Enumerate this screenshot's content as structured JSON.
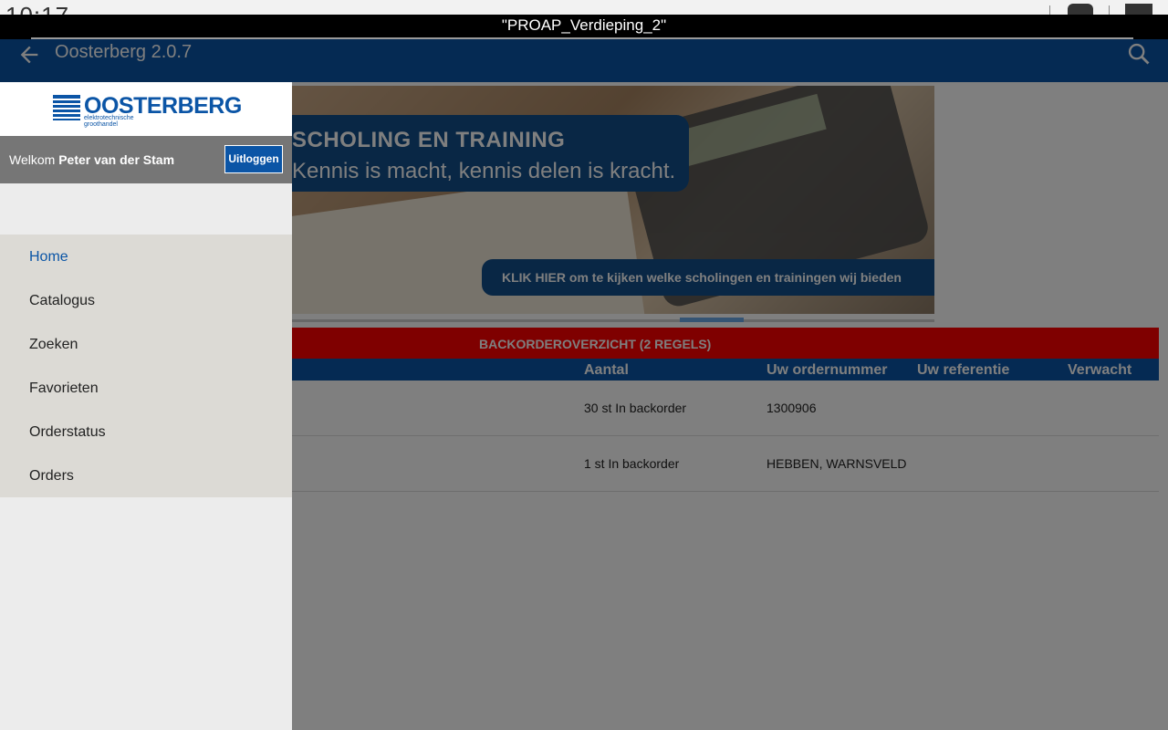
{
  "status_bar": {
    "clock": "10:17"
  },
  "wifi_banner": {
    "text": "\"PROAP_Verdieping_2\""
  },
  "app_bar": {
    "title": "Oosterberg 2.0.7",
    "back_icon": "arrow-left-icon",
    "search_icon": "search-icon"
  },
  "banner": {
    "heading": "SCHOLING EN TRAINING",
    "subheading": "Kennis is macht, kennis delen is kracht.",
    "cta": "KLIK HIER om te kijken welke scholingen en trainingen wij bieden"
  },
  "backorder": {
    "title": "BACKORDEROVERZICHT (2 REGELS)",
    "columns": [
      "Aantal",
      "Uw ordernummer",
      "Uw referentie",
      "Verwacht"
    ],
    "rows": [
      {
        "aantal": "30 st In backorder",
        "ordernummer": "1300906",
        "referentie": "",
        "verwacht": ""
      },
      {
        "aantal": "1 st In backorder",
        "ordernummer": "HEBBEN, WARNSVELD",
        "referentie": "",
        "verwacht": ""
      }
    ]
  },
  "drawer": {
    "logo_text": "OOSTERBERG",
    "logo_sub": "elektrotechnische groothandel",
    "welcome_prefix": "Welkom",
    "user_name": "Peter van der Stam",
    "logout_label": "Uitloggen",
    "menu": [
      {
        "label": "Home",
        "active": true
      },
      {
        "label": "Catalogus",
        "active": false
      },
      {
        "label": "Zoeken",
        "active": false
      },
      {
        "label": "Favorieten",
        "active": false
      },
      {
        "label": "Orderstatus",
        "active": false
      },
      {
        "label": "Orders",
        "active": false
      }
    ]
  },
  "colors": {
    "brand_blue": "#0b55a6",
    "backorder_red": "#ff0000",
    "drawer_menu_bg": "#dcdad5",
    "welcome_bg": "#767676"
  }
}
